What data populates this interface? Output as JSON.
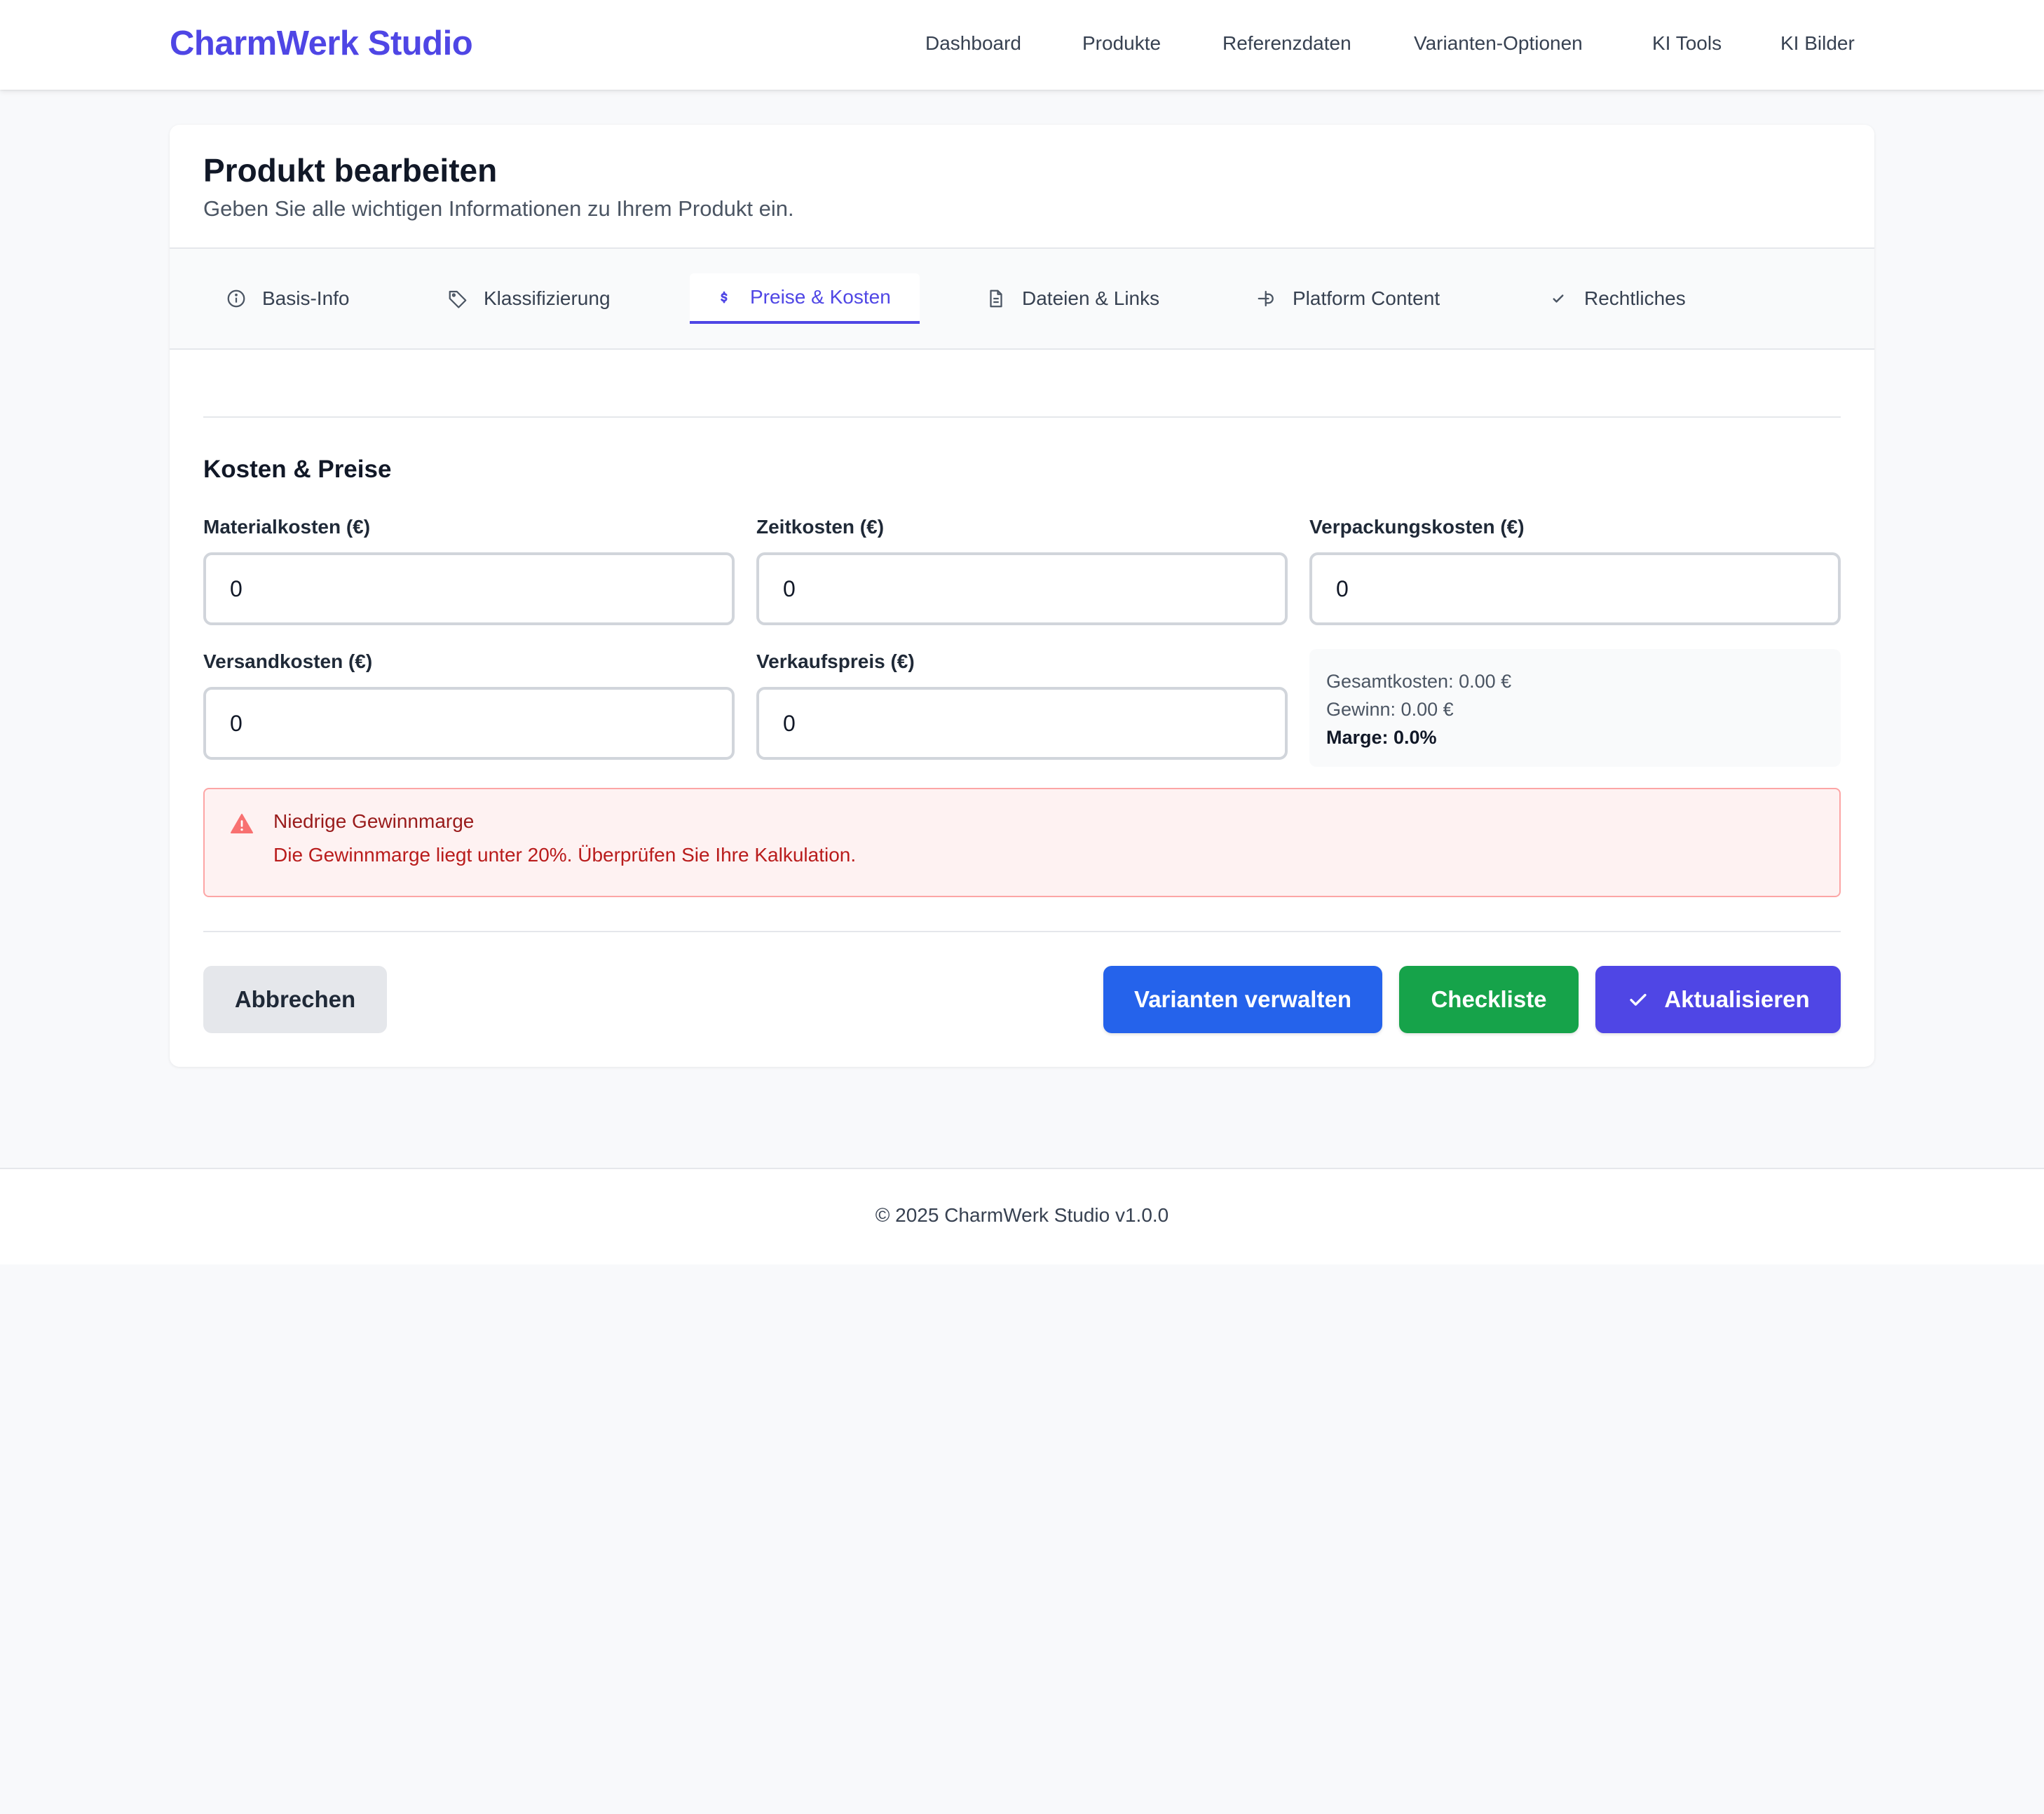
{
  "app": {
    "brand": "CharmWerk Studio"
  },
  "nav": {
    "items": [
      "Dashboard",
      "Produkte",
      "Referenzdaten",
      "Varianten-Optionen",
      "KI Tools",
      "KI Bilder"
    ]
  },
  "page": {
    "title": "Produkt bearbeiten",
    "subtitle": "Geben Sie alle wichtigen Informationen zu Ihrem Produkt ein."
  },
  "tabs": [
    {
      "label": "Basis-Info",
      "icon": "info-circle-icon",
      "active": false
    },
    {
      "label": "Klassifizierung",
      "icon": "tag-icon",
      "active": false
    },
    {
      "label": "Preise & Kosten",
      "icon": "dollar-icon",
      "active": true
    },
    {
      "label": "Dateien & Links",
      "icon": "document-icon",
      "active": false
    },
    {
      "label": "Platform Content",
      "icon": "platform-icon",
      "active": false
    },
    {
      "label": "Rechtliches",
      "icon": "check-badge-icon",
      "active": false
    }
  ],
  "section": {
    "title": "Kosten & Preise"
  },
  "fields": {
    "material": {
      "label": "Materialkosten (€)",
      "value": "0"
    },
    "zeit": {
      "label": "Zeitkosten (€)",
      "value": "0"
    },
    "verpackung": {
      "label": "Verpackungskosten (€)",
      "value": "0"
    },
    "versand": {
      "label": "Versandkosten (€)",
      "value": "0"
    },
    "verkauf": {
      "label": "Verkaufspreis (€)",
      "value": "0"
    }
  },
  "summary": {
    "gesamtkosten": "Gesamtkosten: 0.00 €",
    "gewinn": "Gewinn: 0.00 €",
    "marge": "Marge: 0.0%"
  },
  "alert": {
    "title": "Niedrige Gewinnmarge",
    "message": "Die Gewinnmarge liegt unter 20%. Überprüfen Sie Ihre Kalkulation.",
    "icon": "warning-triangle-icon"
  },
  "actions": {
    "cancel": "Abbrechen",
    "variants": "Varianten verwalten",
    "checklist": "Checkliste",
    "update": "Aktualisieren"
  },
  "footer": {
    "text": "© 2025 CharmWerk Studio v1.0.0"
  },
  "colors": {
    "accent": "#4f46e5",
    "blue": "#2563eb",
    "green": "#16a34a",
    "alert_bg": "#fef2f2",
    "alert_text": "#991b1b"
  }
}
